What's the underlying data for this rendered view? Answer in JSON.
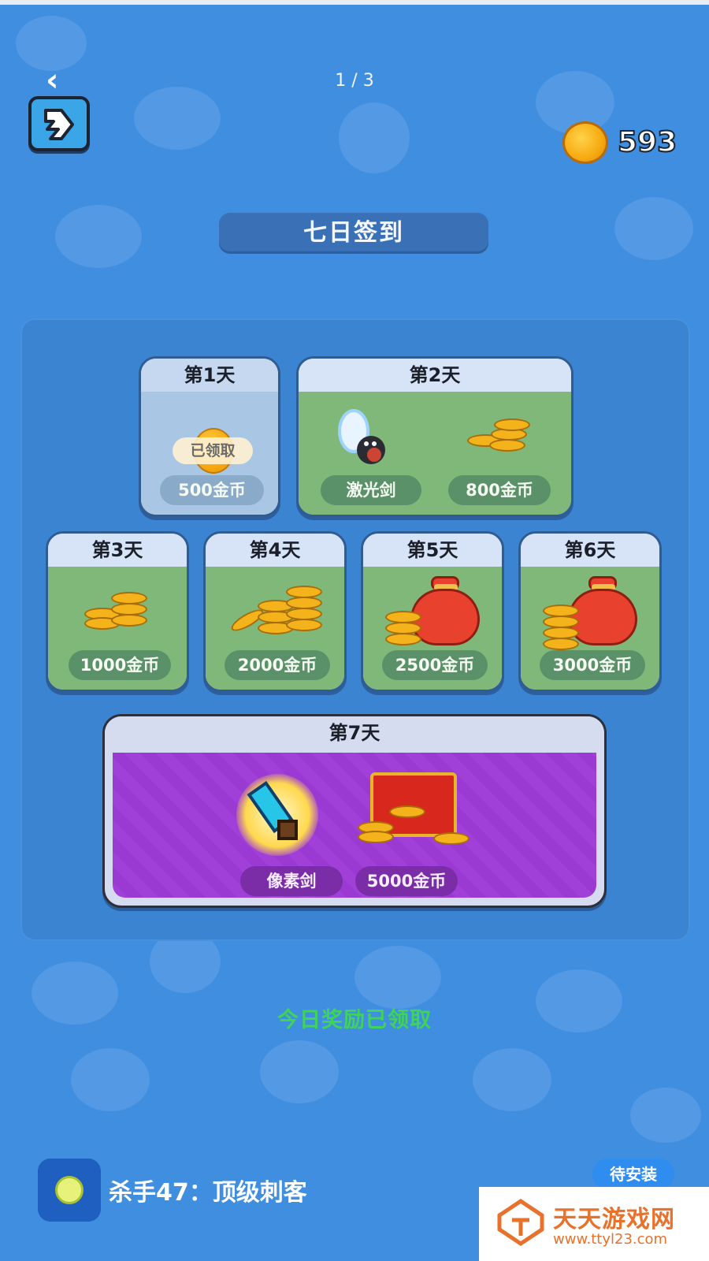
{
  "header": {
    "page_counter": "1 / 3",
    "coin_balance": "593"
  },
  "title": "七日签到",
  "days": [
    {
      "label": "第1天",
      "rewards": [
        {
          "text": "500金币"
        }
      ],
      "claimed_badge": "已领取"
    },
    {
      "label": "第2天",
      "rewards": [
        {
          "text": "激光剑"
        },
        {
          "text": "800金币"
        }
      ]
    },
    {
      "label": "第3天",
      "rewards": [
        {
          "text": "1000金币"
        }
      ]
    },
    {
      "label": "第4天",
      "rewards": [
        {
          "text": "2000金币"
        }
      ]
    },
    {
      "label": "第5天",
      "rewards": [
        {
          "text": "2500金币"
        }
      ]
    },
    {
      "label": "第6天",
      "rewards": [
        {
          "text": "3000金币"
        }
      ]
    },
    {
      "label": "第7天",
      "rewards": [
        {
          "text": "像素剑"
        },
        {
          "text": "5000金币"
        }
      ]
    }
  ],
  "status_text": "今日奖励已领取",
  "ad": {
    "app_name": "杀手47：顶级刺客",
    "button": "待安装"
  },
  "watermark": {
    "name": "天天游戏网",
    "url": "www.ttyl23.com"
  },
  "colors": {
    "background": "#3f8ee0",
    "accent_green": "#3fd35a",
    "coin_gold": "#f4b21b",
    "day7_purple": "#a040d8"
  },
  "icons": [
    "back-chevron-icon",
    "exit-icon",
    "coin-icon",
    "laser-sword-icon",
    "coin-stack-icon",
    "money-bag-icon",
    "pixel-sword-icon",
    "treasure-chest-icon"
  ]
}
